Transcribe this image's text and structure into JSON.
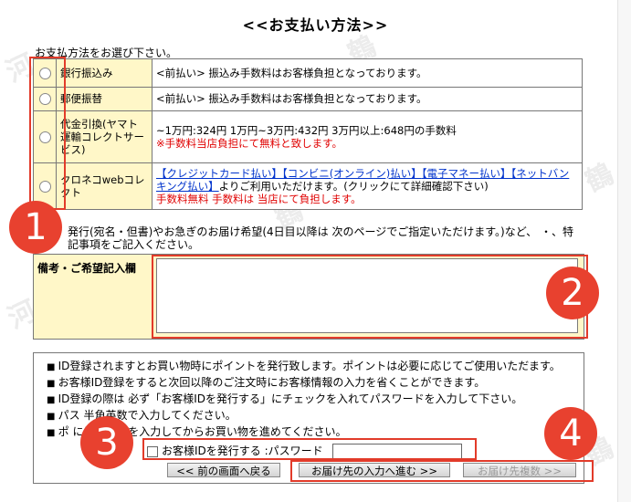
{
  "title": "<<お支払い方法>>",
  "select_prompt": "お支払方法をお選び下さい。",
  "payment_methods": [
    {
      "name": "銀行振込み",
      "desc": "<前払い> 振込み手数料はお客様負担となっております。"
    },
    {
      "name": "郵便振替",
      "desc": "<前払い> 振込み手数料はお客様負担となっております。"
    },
    {
      "name": "代金引換(ヤマト運輸コレクトサービス)",
      "desc": "~1万円:324円 1万円~3万円:432円 3万円以上:648円の手数料",
      "note": "※手数料当店負担にて無料と致します。"
    },
    {
      "name": "クロネコwebコレクト",
      "links": [
        "【クレジットカード払い】",
        "【コンビニ(オンライン)払い】",
        "【電子マネー払い】",
        "【ネットバンキング払い】"
      ],
      "desc_after_links": "よりご利用いただけます。(クリックにて詳細確認下さい)",
      "note": "手数料無料 手数料は 当店にて負担します。"
    }
  ],
  "remarks_note": "発行(宛名・但書)やお急ぎのお届け希望(4日目以降は 次のページでご指定いただけます。)など、 ・、特記事項をご記入ください。",
  "remarks_label": "備考・ご希望記入欄",
  "info_items": [
    "ID登録されますとお買い物時にポイントを発行致します。ポイントは必要に応じてご使用いただます。",
    "お客様ID登録をすると次回以降のご注文時にお客様情報の入力を省くことができます。",
    "ID登録の際は 必ず「お客様IDを発行する」にチェックを入れてパスワードを入力して下さい。",
    "パス 半角英数で入力してください。",
    "ポ には必ずIDを入力してからお買い物を進めてください。"
  ],
  "issue_id_label": "お客様IDを発行する :パスワード",
  "buttons": {
    "back": "<< 前の画面へ戻る",
    "next": "お届け先の入力へ進む >>",
    "copy": "お届け先複数 >>"
  },
  "markers": [
    "1",
    "2",
    "3",
    "4"
  ],
  "colors": {
    "highlight": "#e23b2a",
    "marker": "#e8412f",
    "row_bg": "#fff7c8"
  }
}
